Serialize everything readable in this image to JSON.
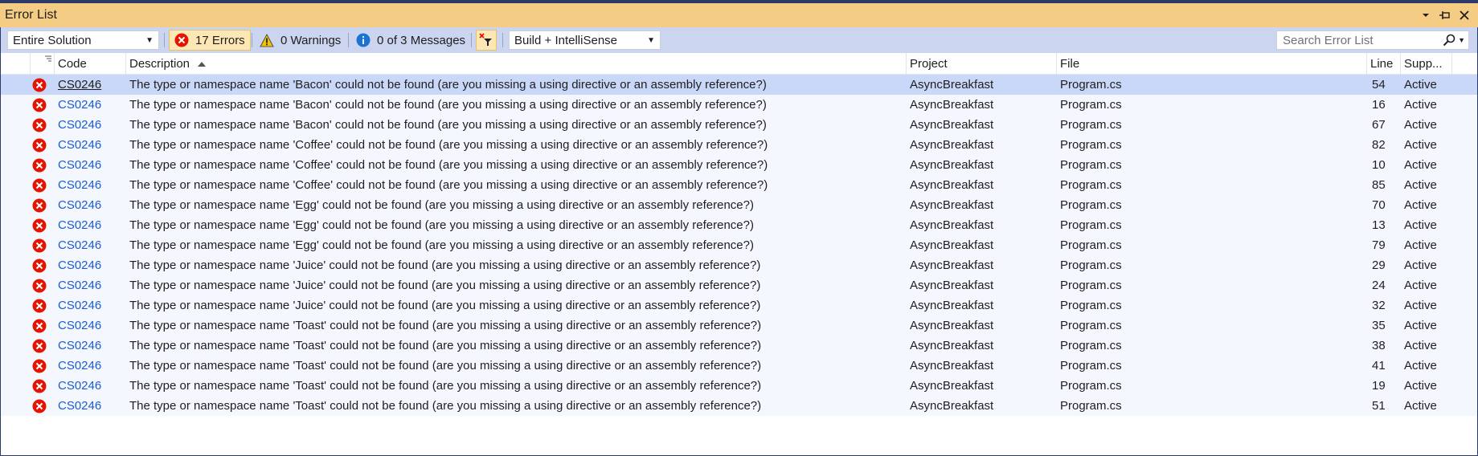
{
  "window": {
    "title": "Error List"
  },
  "toolbar": {
    "scope": "Entire Solution",
    "errors_label": "17 Errors",
    "warnings_label": "0 Warnings",
    "messages_label": "0 of 3 Messages",
    "build_filter": "Build + IntelliSense",
    "search_placeholder": "Search Error List"
  },
  "columns": {
    "code": "Code",
    "description": "Description",
    "project": "Project",
    "file": "File",
    "line": "Line",
    "suppression": "Supp..."
  },
  "rows": [
    {
      "code": "CS0246",
      "description": "The type or namespace name 'Bacon' could not be found (are you missing a using directive or an assembly reference?)",
      "project": "AsyncBreakfast",
      "file": "Program.cs",
      "line": "54",
      "suppression": "Active"
    },
    {
      "code": "CS0246",
      "description": "The type or namespace name 'Bacon' could not be found (are you missing a using directive or an assembly reference?)",
      "project": "AsyncBreakfast",
      "file": "Program.cs",
      "line": "16",
      "suppression": "Active"
    },
    {
      "code": "CS0246",
      "description": "The type or namespace name 'Bacon' could not be found (are you missing a using directive or an assembly reference?)",
      "project": "AsyncBreakfast",
      "file": "Program.cs",
      "line": "67",
      "suppression": "Active"
    },
    {
      "code": "CS0246",
      "description": "The type or namespace name 'Coffee' could not be found (are you missing a using directive or an assembly reference?)",
      "project": "AsyncBreakfast",
      "file": "Program.cs",
      "line": "82",
      "suppression": "Active"
    },
    {
      "code": "CS0246",
      "description": "The type or namespace name 'Coffee' could not be found (are you missing a using directive or an assembly reference?)",
      "project": "AsyncBreakfast",
      "file": "Program.cs",
      "line": "10",
      "suppression": "Active"
    },
    {
      "code": "CS0246",
      "description": "The type or namespace name 'Coffee' could not be found (are you missing a using directive or an assembly reference?)",
      "project": "AsyncBreakfast",
      "file": "Program.cs",
      "line": "85",
      "suppression": "Active"
    },
    {
      "code": "CS0246",
      "description": "The type or namespace name 'Egg' could not be found (are you missing a using directive or an assembly reference?)",
      "project": "AsyncBreakfast",
      "file": "Program.cs",
      "line": "70",
      "suppression": "Active"
    },
    {
      "code": "CS0246",
      "description": "The type or namespace name 'Egg' could not be found (are you missing a using directive or an assembly reference?)",
      "project": "AsyncBreakfast",
      "file": "Program.cs",
      "line": "13",
      "suppression": "Active"
    },
    {
      "code": "CS0246",
      "description": "The type or namespace name 'Egg' could not be found (are you missing a using directive or an assembly reference?)",
      "project": "AsyncBreakfast",
      "file": "Program.cs",
      "line": "79",
      "suppression": "Active"
    },
    {
      "code": "CS0246",
      "description": "The type or namespace name 'Juice' could not be found (are you missing a using directive or an assembly reference?)",
      "project": "AsyncBreakfast",
      "file": "Program.cs",
      "line": "29",
      "suppression": "Active"
    },
    {
      "code": "CS0246",
      "description": "The type or namespace name 'Juice' could not be found (are you missing a using directive or an assembly reference?)",
      "project": "AsyncBreakfast",
      "file": "Program.cs",
      "line": "24",
      "suppression": "Active"
    },
    {
      "code": "CS0246",
      "description": "The type or namespace name 'Juice' could not be found (are you missing a using directive or an assembly reference?)",
      "project": "AsyncBreakfast",
      "file": "Program.cs",
      "line": "32",
      "suppression": "Active"
    },
    {
      "code": "CS0246",
      "description": "The type or namespace name 'Toast' could not be found (are you missing a using directive or an assembly reference?)",
      "project": "AsyncBreakfast",
      "file": "Program.cs",
      "line": "35",
      "suppression": "Active"
    },
    {
      "code": "CS0246",
      "description": "The type or namespace name 'Toast' could not be found (are you missing a using directive or an assembly reference?)",
      "project": "AsyncBreakfast",
      "file": "Program.cs",
      "line": "38",
      "suppression": "Active"
    },
    {
      "code": "CS0246",
      "description": "The type or namespace name 'Toast' could not be found (are you missing a using directive or an assembly reference?)",
      "project": "AsyncBreakfast",
      "file": "Program.cs",
      "line": "41",
      "suppression": "Active"
    },
    {
      "code": "CS0246",
      "description": "The type or namespace name 'Toast' could not be found (are you missing a using directive or an assembly reference?)",
      "project": "AsyncBreakfast",
      "file": "Program.cs",
      "line": "19",
      "suppression": "Active"
    },
    {
      "code": "CS0246",
      "description": "The type or namespace name 'Toast' could not be found (are you missing a using directive or an assembly reference?)",
      "project": "AsyncBreakfast",
      "file": "Program.cs",
      "line": "51",
      "suppression": "Active"
    }
  ],
  "icons": {
    "error": "error-circle-icon",
    "warning": "warning-triangle-icon",
    "info": "info-circle-icon",
    "filter": "filter-toggle-icon",
    "search": "search-icon",
    "sort": "sort-ascending-icon"
  },
  "colors": {
    "title_bar": "#f5cc84",
    "toolbar": "#ccd5f0",
    "selected_row": "#c9d8f8",
    "row": "#f5f7fe",
    "error": "#e51400",
    "link": "#1a5ccf"
  }
}
